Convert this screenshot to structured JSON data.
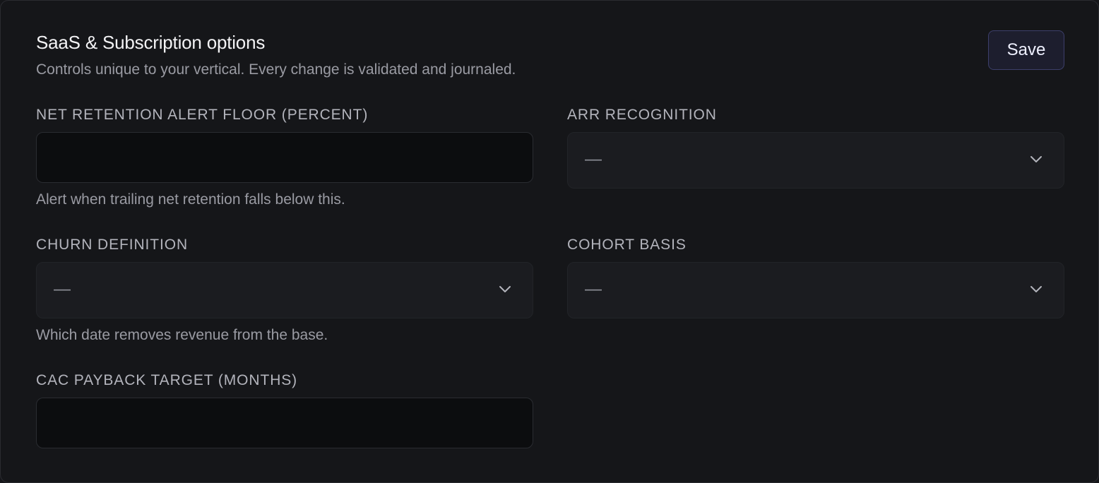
{
  "header": {
    "title": "SaaS & Subscription options",
    "subtitle": "Controls unique to your vertical. Every change is validated and journaled.",
    "save_label": "Save"
  },
  "fields": {
    "net_retention": {
      "label": "NET RETENTION ALERT FLOOR (PERCENT)",
      "value": "",
      "help": "Alert when trailing net retention falls below this."
    },
    "arr_recognition": {
      "label": "ARR RECOGNITION",
      "selected": "—",
      "icon": "chevron-down-icon"
    },
    "churn_definition": {
      "label": "CHURN DEFINITION",
      "selected": "—",
      "help": "Which date removes revenue from the base.",
      "icon": "chevron-down-icon"
    },
    "cohort_basis": {
      "label": "COHORT BASIS",
      "selected": "—",
      "icon": "chevron-down-icon"
    },
    "cac_payback": {
      "label": "CAC PAYBACK TARGET (MONTHS)",
      "value": ""
    }
  },
  "colors": {
    "background": "#151619",
    "input_background": "#0c0d0f",
    "select_background": "#1b1c20",
    "accent_border": "#3c3f6b"
  }
}
